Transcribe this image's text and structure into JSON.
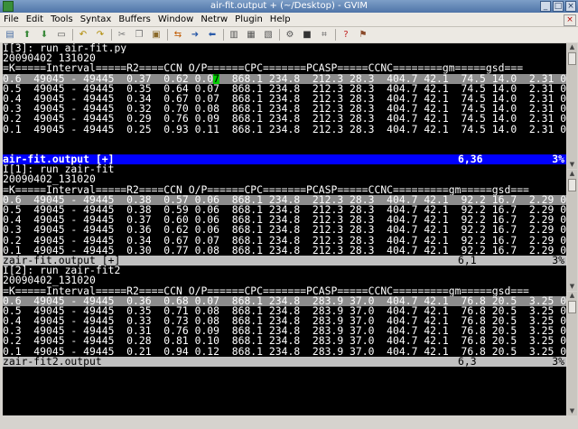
{
  "window": {
    "title": "air-fit.output + (~/Desktop) - GVIM"
  },
  "menu": [
    "File",
    "Edit",
    "Tools",
    "Syntax",
    "Buffers",
    "Window",
    "Netrw",
    "Plugin",
    "Help"
  ],
  "toolbar": [
    {
      "name": "open-icon",
      "glyph": "▤",
      "color": "#4a6fa5"
    },
    {
      "name": "save-icon",
      "glyph": "⬆",
      "color": "#3c8a3c"
    },
    {
      "name": "save-all-icon",
      "glyph": "⬇",
      "color": "#3c8a3c"
    },
    {
      "name": "print-icon",
      "glyph": "▭",
      "color": "#555555"
    },
    {
      "sep": true
    },
    {
      "name": "undo-icon",
      "glyph": "↶",
      "color": "#b08a00"
    },
    {
      "name": "redo-icon",
      "glyph": "↷",
      "color": "#b08a00"
    },
    {
      "sep": true
    },
    {
      "name": "cut-icon",
      "glyph": "✂",
      "color": "#777777"
    },
    {
      "name": "copy-icon",
      "glyph": "❐",
      "color": "#777777"
    },
    {
      "name": "paste-icon",
      "glyph": "▣",
      "color": "#8a6a2a"
    },
    {
      "sep": true
    },
    {
      "name": "replace-icon",
      "glyph": "⇆",
      "color": "#c05a00"
    },
    {
      "name": "find-next-icon",
      "glyph": "➜",
      "color": "#2a5aa8"
    },
    {
      "name": "find-prev-icon",
      "glyph": "⬅",
      "color": "#2a5aa8"
    },
    {
      "sep": true
    },
    {
      "name": "load-session-icon",
      "glyph": "▥",
      "color": "#555555"
    },
    {
      "name": "save-session-icon",
      "glyph": "▦",
      "color": "#555555"
    },
    {
      "name": "run-script-icon",
      "glyph": "▧",
      "color": "#555555"
    },
    {
      "sep": true
    },
    {
      "name": "make-icon",
      "glyph": "⚙",
      "color": "#555555"
    },
    {
      "name": "shell-icon",
      "glyph": "■",
      "color": "#333333"
    },
    {
      "name": "ctags-icon",
      "glyph": "⌗",
      "color": "#555555"
    },
    {
      "sep": true
    },
    {
      "name": "help-icon",
      "glyph": "?",
      "color": "#c02020"
    },
    {
      "name": "find-help-icon",
      "glyph": "⚑",
      "color": "#8a4a2a"
    }
  ],
  "windows": [
    {
      "lines": [
        "I[3]: run air-fit.py",
        "20090402_131020",
        "=K=====Interval=====R2====CCN O/P======CPC=======PCASP=====CCNC========gm=====gsd==="
      ],
      "rows": [
        {
          "pre": "0.6  49045 - 49445  0.37  0.62 0.0",
          "cur": "7",
          "post": "  868.1 234.8  212.3 28.3  404.7 42.1  74.5 14.0  2.31 0.31",
          "hl": true
        },
        {
          "pre": "0.5  49045 - 49445  0.35  0.64 0.07  868.1 234.8  212.3 28.3  404.7 42.1  74.5 14.0  2.31 0.31"
        },
        {
          "pre": "0.4  49045 - 49445  0.34  0.67 0.07  868.1 234.8  212.3 28.3  404.7 42.1  74.5 14.0  2.31 0.31"
        },
        {
          "pre": "0.3  49045 - 49445  0.32  0.70 0.08  868.1 234.8  212.3 28.3  404.7 42.1  74.5 14.0  2.31 0.31"
        },
        {
          "pre": "0.2  49045 - 49445  0.29  0.76 0.09  868.1 234.8  212.3 28.3  404.7 42.1  74.5 14.0  2.31 0.31"
        },
        {
          "pre": "0.1  49045 - 49445  0.25  0.93 0.11  868.1 234.8  212.3 28.3  404.7 42.1  74.5 14.0  2.31 0.31"
        }
      ],
      "blank": 2,
      "status": {
        "name": "air-fit.output [+]",
        "pos": "6,36",
        "pct": "3%",
        "active": true
      }
    },
    {
      "lines": [
        "I[1]: run zair-fit",
        "20090402_131020",
        "=K=====Interval=====R2====CCN O/P======CPC=======PCASP=====CCNC=========gm=====gsd==="
      ],
      "rows": [
        {
          "pre": "0.6  49045 - 49445  0.38  0.57 0.06  868.1 234.8  212.3 28.3  404.7 42.1  92.2 16.7  2.29 0.37",
          "hl": true
        },
        {
          "pre": "0.5  49045 - 49445  0.38  0.59 0.06  868.1 234.8  212.3 28.3  404.7 42.1  92.2 16.7  2.29 0.37"
        },
        {
          "pre": "0.4  49045 - 49445  0.37  0.60 0.06  868.1 234.8  212.3 28.3  404.7 42.1  92.2 16.7  2.29 0.37"
        },
        {
          "pre": "0.3  49045 - 49445  0.36  0.62 0.06  868.1 234.8  212.3 28.3  404.7 42.1  92.2 16.7  2.29 0.37"
        },
        {
          "pre": "0.2  49045 - 49445  0.34  0.67 0.07  868.1 234.8  212.3 28.3  404.7 42.1  92.2 16.7  2.29 0.37"
        },
        {
          "pre": "0.1  49045 - 49445  0.30  0.77 0.08  868.1 234.8  212.3 28.3  404.7 42.1  92.2 16.7  2.29 0.37"
        }
      ],
      "blank": 0,
      "status": {
        "name": "zair-fit.output [+]",
        "pos": "6,1",
        "pct": "3%",
        "active": false
      }
    },
    {
      "lines": [
        "I[2]: run zair-fit2",
        "20090402_131020",
        "=K=====Interval=====R2====CCN O/P======CPC=======PCASP=====CCNC=========gm=====gsd==="
      ],
      "rows": [
        {
          "pre": "0.6  49045 - 49445  0.36  0.68 0.07  868.1 234.8  283.9 37.0  404.7 42.1  76.8 20.5  3.25 0.37",
          "hl": true
        },
        {
          "pre": "0.5  49045 - 49445  0.35  0.71 0.08  868.1 234.8  283.9 37.0  404.7 42.1  76.8 20.5  3.25 0.37"
        },
        {
          "pre": "0.4  49045 - 49445  0.33  0.73 0.08  868.1 234.8  283.9 37.0  404.7 42.1  76.8 20.5  3.25 0.37"
        },
        {
          "pre": "0.3  49045 - 49445  0.31  0.76 0.09  868.1 234.8  283.9 37.0  404.7 42.1  76.8 20.5  3.25 0.37"
        },
        {
          "pre": "0.2  49045 - 49445  0.28  0.81 0.10  868.1 234.8  283.9 37.0  404.7 42.1  76.8 20.5  3.25 0.37"
        },
        {
          "pre": "0.1  49045 - 49445  0.21  0.94 0.12  868.1 234.8  283.9 37.0  404.7 42.1  76.8 20.5  3.25 0.37"
        }
      ],
      "blank": 0,
      "status": {
        "name": "zair-fit2.output",
        "pos": "6,3",
        "pct": "3%",
        "active": false
      }
    }
  ]
}
